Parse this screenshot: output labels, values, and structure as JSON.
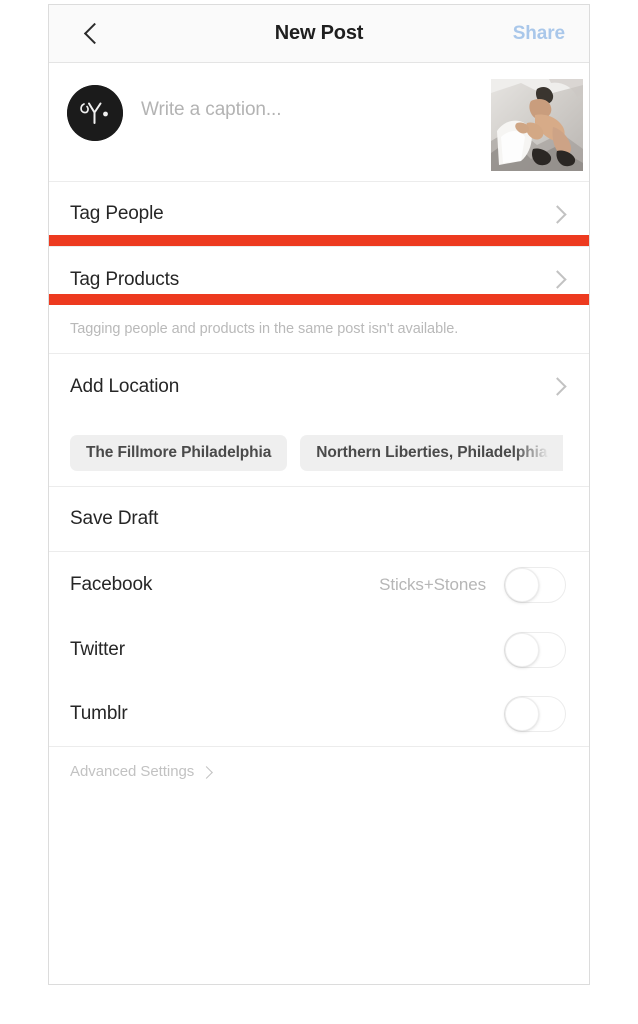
{
  "navbar": {
    "back_icon": "chevron-left-icon",
    "title": "New Post",
    "share_label": "Share",
    "share_color": "#a9c7ea"
  },
  "caption": {
    "avatar_icon": "user-avatar-logo",
    "placeholder": "Write a caption...",
    "thumbnail_icon": "post-image-thumbnail"
  },
  "rows": {
    "tag_people": {
      "label": "Tag People",
      "chevron_icon": "chevron-right-icon"
    },
    "tag_products": {
      "label": "Tag Products",
      "chevron_icon": "chevron-right-icon",
      "highlight_color": "#ed3a1f"
    },
    "note": "Tagging people and products in the same post isn't available.",
    "add_location": {
      "label": "Add Location",
      "chevron_icon": "chevron-right-icon"
    },
    "save_draft": {
      "label": "Save Draft"
    }
  },
  "location_chips": [
    {
      "label": "The Fillmore Philadelphia"
    },
    {
      "label": "Northern Liberties, Philadelphia"
    }
  ],
  "social": [
    {
      "label": "Facebook",
      "sublabel": "Sticks+Stones",
      "toggle_state": "off"
    },
    {
      "label": "Twitter",
      "sublabel": "",
      "toggle_state": "off"
    },
    {
      "label": "Tumblr",
      "sublabel": "",
      "toggle_state": "off"
    }
  ],
  "advanced": {
    "label": "Advanced Settings",
    "chevron_icon": "chevron-right-icon"
  }
}
